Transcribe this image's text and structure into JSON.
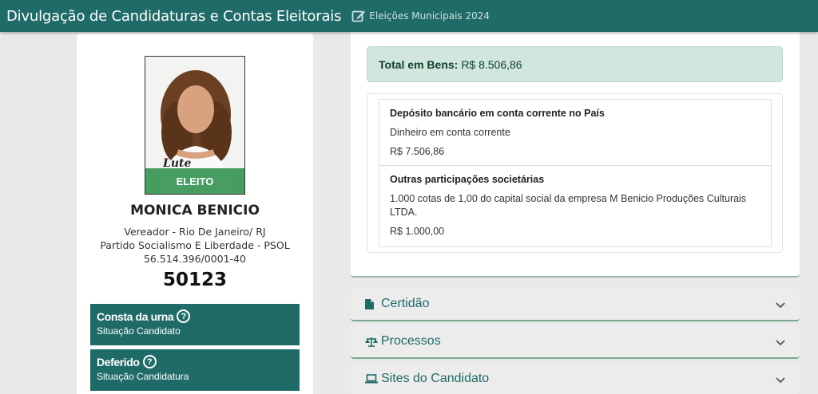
{
  "header": {
    "title": "Divulgação de Candidaturas e Contas Eleitorais",
    "subtitle": "Eleições Municipais 2024"
  },
  "candidate": {
    "badge": "ELEITO",
    "name": "MONICA BENICIO",
    "office": "Vereador - Rio De Janeiro/ RJ",
    "party": "Partido Socialismo E Liberdade - PSOL",
    "cnpj": "56.514.396/0001-40",
    "number": "50123",
    "statuses": [
      {
        "title": "Consta da urna",
        "subtitle": "Situação Candidato"
      },
      {
        "title": "Deferido",
        "subtitle": "Situação Candidatura"
      }
    ]
  },
  "assets": {
    "total_label": "Total em Bens:",
    "total_value": "R$ 8.506,86",
    "items": [
      {
        "title": "Depósito bancário em conta corrente no País",
        "description": "Dinheiro em conta corrente",
        "value": "R$ 7.506,86"
      },
      {
        "title": "Outras participações societárias",
        "description": "1.000 cotas de 1,00 do capital social da empresa M Benicio Produções Culturais LTDA.",
        "value": "R$ 1.000,00"
      }
    ]
  },
  "sections": [
    {
      "label": "Certidão",
      "icon": "file-icon"
    },
    {
      "label": "Processos",
      "icon": "scale-icon"
    },
    {
      "label": "Sites do Candidato",
      "icon": "laptop-icon"
    }
  ],
  "colors": {
    "primary": "#1f6b68",
    "success_bg": "#d1e7dd",
    "eleito": "#288c46"
  }
}
